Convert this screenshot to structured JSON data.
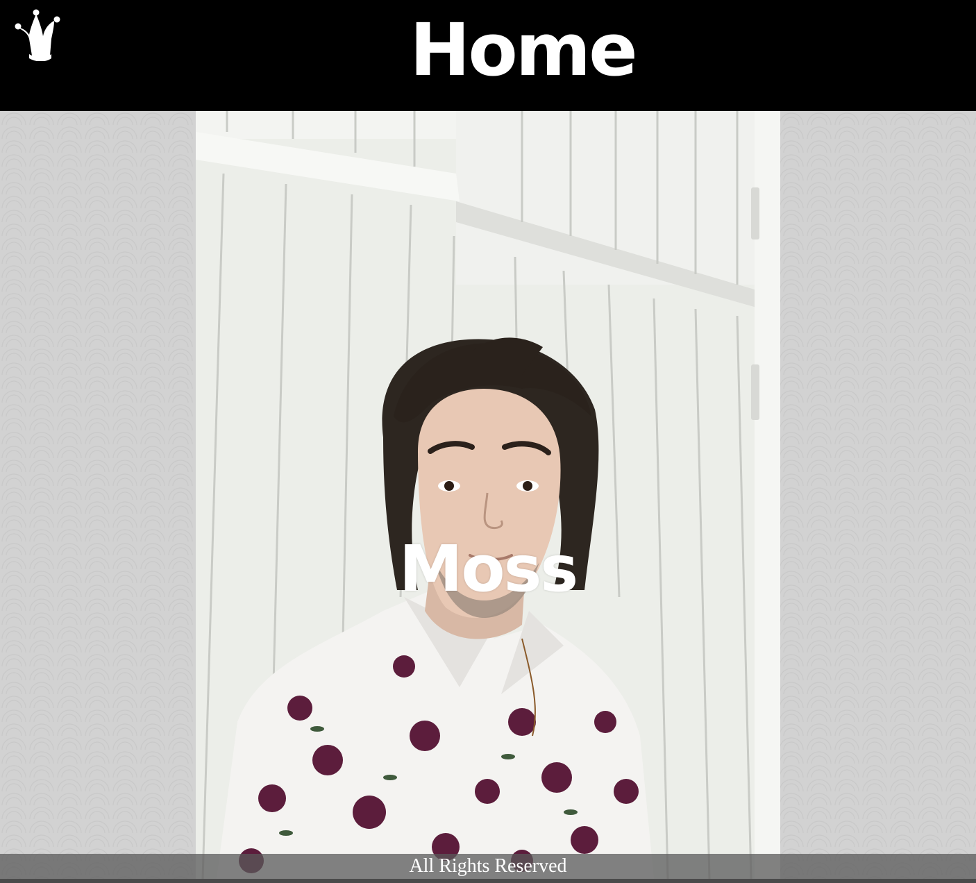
{
  "header": {
    "title": "Home",
    "logo_icon": "jester-hat-icon"
  },
  "main": {
    "photo_icon": "portrait-photo",
    "name": "Moss"
  },
  "footer": {
    "text": "All Rights Reserved"
  },
  "colors": {
    "header_bg": "#000000",
    "page_bg": "#d2d2d2",
    "text": "#ffffff",
    "shirt_flowers": "#5c1d3c"
  }
}
